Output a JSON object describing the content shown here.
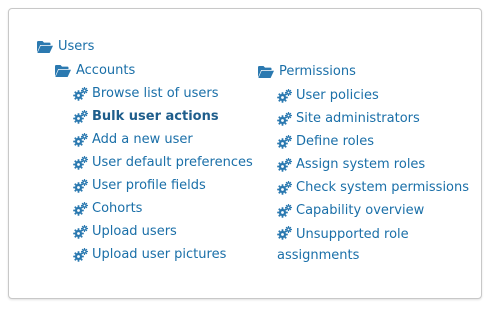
{
  "tree": {
    "root": {
      "label": "Users",
      "icon": "folder-open-icon"
    },
    "accounts": {
      "label": "Accounts",
      "icon": "folder-open-icon",
      "items": [
        {
          "label": "Browse list of users",
          "bold": false,
          "icon": "gears-icon"
        },
        {
          "label": "Bulk user actions",
          "bold": true,
          "icon": "gears-icon"
        },
        {
          "label": "Add a new user",
          "bold": false,
          "icon": "gears-icon"
        },
        {
          "label": "User default preferences",
          "bold": false,
          "icon": "gears-icon"
        },
        {
          "label": "User profile fields",
          "bold": false,
          "icon": "gears-icon"
        },
        {
          "label": "Cohorts",
          "bold": false,
          "icon": "gears-icon"
        },
        {
          "label": "Upload users",
          "bold": false,
          "icon": "gears-icon"
        },
        {
          "label": "Upload user pictures",
          "bold": false,
          "icon": "gears-icon"
        }
      ]
    },
    "permissions": {
      "label": "Permissions",
      "icon": "folder-open-icon",
      "items": [
        {
          "label": "User policies",
          "icon": "gears-icon"
        },
        {
          "label": "Site administrators",
          "icon": "gears-icon"
        },
        {
          "label": "Define roles",
          "icon": "gears-icon"
        },
        {
          "label": "Assign system roles",
          "icon": "gears-icon"
        },
        {
          "label": "Check system permissions",
          "icon": "gears-icon"
        },
        {
          "label": "Capability overview",
          "icon": "gears-icon"
        },
        {
          "label": "Unsupported role assignments",
          "icon": "gears-icon"
        }
      ]
    }
  },
  "colors": {
    "link": "#1a6fa8",
    "icon": "#2b79b0",
    "border": "#c8c8c8"
  }
}
